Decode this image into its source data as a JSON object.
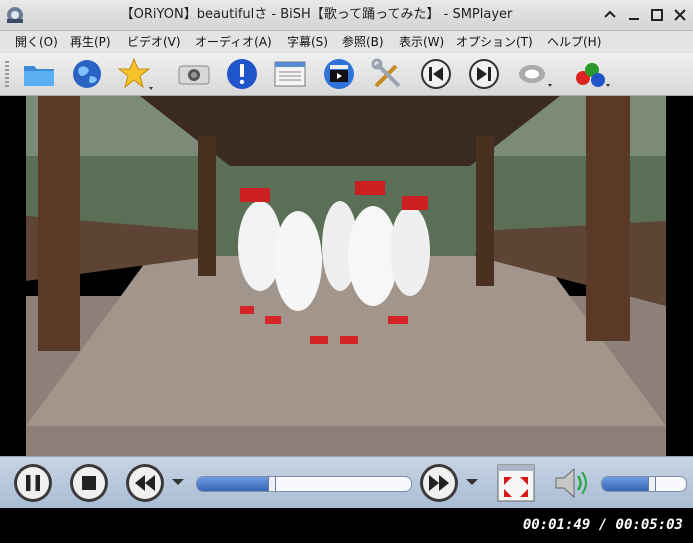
{
  "window": {
    "title": "【ORiYON】beautifulさ - BiSH【歌って踊ってみた】 - SMPlayer",
    "app_icon": "smplayer-icon",
    "buttons": [
      "restore-icon",
      "minimize-icon",
      "maximize-icon",
      "close-icon"
    ]
  },
  "menu": {
    "items": [
      {
        "label": "開く(O)"
      },
      {
        "label": "再生(P)"
      },
      {
        "label": "ビデオ(V)"
      },
      {
        "label": "オーディオ(A)"
      },
      {
        "label": "字幕(S)"
      },
      {
        "label": "参照(B)"
      },
      {
        "label": "表示(W)"
      },
      {
        "label": "オプション(T)"
      },
      {
        "label": "ヘルプ(H)"
      }
    ]
  },
  "toolbar": {
    "icons": [
      "folder-icon",
      "globe-icon",
      "favorites-star-icon",
      "screenshot-camera-icon",
      "info-icon",
      "playlist-icon",
      "video-clapper-icon",
      "preferences-tools-icon",
      "previous-icon",
      "next-icon",
      "audio-disc-icon",
      "subtitles-abc-icon"
    ]
  },
  "video": {
    "description": "dance video scene"
  },
  "controls": {
    "seek_progress": 0.35,
    "volume_level": 0.6,
    "icons": [
      "pause-icon",
      "stop-icon",
      "rewind-icon",
      "forward-icon",
      "fullscreen-icon",
      "volume-icon"
    ]
  },
  "status": {
    "time": "00:01:49 / 00:05:03"
  },
  "colors": {
    "accent": "#3565b8",
    "controls_bg": "#b4c4d8"
  }
}
